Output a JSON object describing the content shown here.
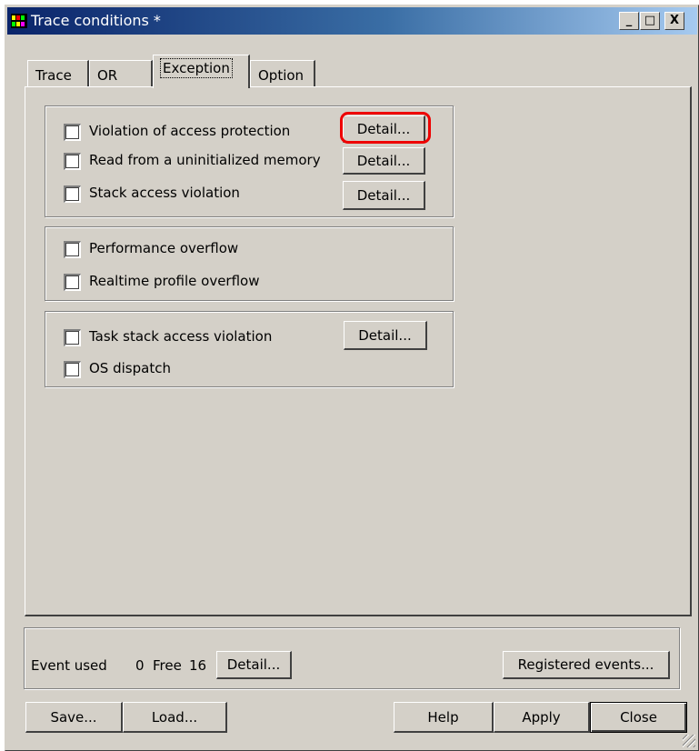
{
  "window": {
    "title": "Trace conditions *",
    "buttons": {
      "minimize": "_",
      "maximize": "□",
      "close": "X"
    }
  },
  "tabs": [
    {
      "label": "Trace"
    },
    {
      "label": "OR"
    },
    {
      "label": "Exception",
      "active": true
    },
    {
      "label": "Option"
    }
  ],
  "groups": {
    "access": [
      {
        "label": "Violation of access protection",
        "checked": false,
        "detail": "Detail..."
      },
      {
        "label": "Read from a uninitialized memory",
        "checked": false,
        "detail": "Detail..."
      },
      {
        "label": "Stack access violation",
        "checked": false,
        "detail": "Detail..."
      }
    ],
    "profile": [
      {
        "label": "Performance overflow",
        "checked": false
      },
      {
        "label": "Realtime profile overflow",
        "checked": false
      }
    ],
    "os": [
      {
        "label": "Task stack access violation",
        "checked": false,
        "detail": "Detail..."
      },
      {
        "label": "OS dispatch",
        "checked": false
      }
    ]
  },
  "events": {
    "used_label": "Event used",
    "used_value": "0",
    "free_label": "Free",
    "free_value": "16",
    "detail": "Detail...",
    "registered": "Registered events..."
  },
  "footer": {
    "save": "Save...",
    "load": "Load...",
    "help": "Help",
    "apply": "Apply",
    "close": "Close"
  },
  "colors": {
    "dialog_bg": "#d4d0c8",
    "titlebar_start": "#0a246a",
    "titlebar_end": "#a6caf0",
    "highlight": "#ee0000"
  }
}
